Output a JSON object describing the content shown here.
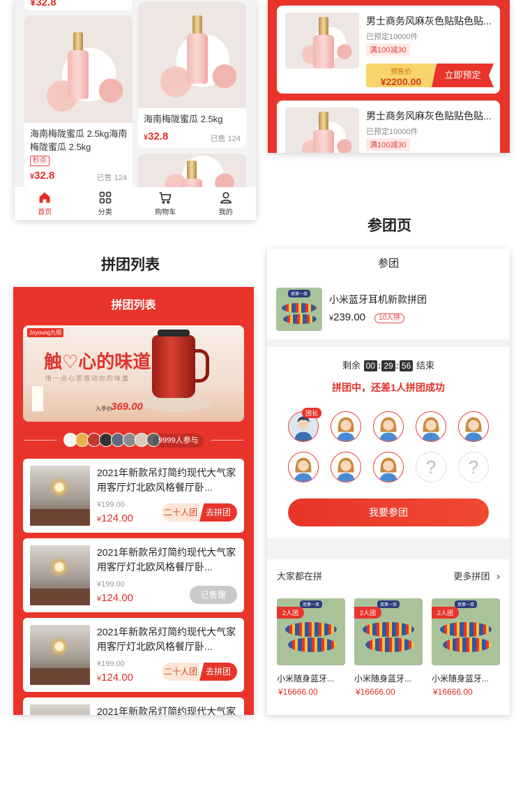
{
  "home": {
    "top_price_cut": "¥32.8",
    "cards": [
      {
        "title": "海南梅陇蜜瓜 2.5kg海南梅陇蜜瓜 2.5kg",
        "tag": "秒杀",
        "price_symbol": "¥",
        "price": "32.8",
        "sold": "已售 124"
      },
      {
        "title": "海南梅陇蜜瓜 2.5kg",
        "price_symbol": "¥",
        "price": "32.8",
        "sold": "已售 124"
      }
    ],
    "tabs": [
      {
        "label": "首页",
        "icon": "home-icon"
      },
      {
        "label": "分类",
        "icon": "category-icon"
      },
      {
        "label": "购物车",
        "icon": "cart-icon"
      },
      {
        "label": "我的",
        "icon": "user-icon"
      }
    ]
  },
  "presale": {
    "items": [
      {
        "title": "男士商务风麻灰色贴贴色贴...",
        "booked": "已预定10000件",
        "discount": "满100减30",
        "price_label": "预售价",
        "price": "¥2200.00",
        "button": "立即预定"
      },
      {
        "title": "男士商务风麻灰色贴贴色贴...",
        "booked": "已预定10000件",
        "discount": "满100减30"
      }
    ]
  },
  "section_titles": {
    "join_page": "参团页",
    "group_list": "拼团列表"
  },
  "group_list": {
    "header": "拼团列表",
    "banner": {
      "brand": "Joyoung九阳",
      "slogan": "触♡心的味道",
      "slogan_sub": "用一点心思感动你的味蕾",
      "price_label": "入手价",
      "price": "369.00"
    },
    "participants": "9999人参与",
    "items": [
      {
        "title": "2021年新款吊灯简约现代大气家用客厅灯北欧风格餐厅卧...",
        "old_price": "¥199.00",
        "price_symbol": "¥",
        "price": "124.00",
        "size_label": "二十人团",
        "action": "去拼团"
      },
      {
        "title": "2021年新款吊灯简约现代大气家用客厅灯北欧风格餐厅卧...",
        "old_price": "¥199.00",
        "price_symbol": "¥",
        "price": "124.00",
        "action": "已售罄"
      },
      {
        "title": "2021年新款吊灯简约现代大气家用客厅灯北欧风格餐厅卧...",
        "old_price": "¥199.00",
        "price_symbol": "¥",
        "price": "124.00",
        "size_label": "二十人团",
        "action": "去拼团"
      },
      {
        "title": "2021年新款吊灯简约现代大气家"
      }
    ]
  },
  "join_group": {
    "header": "参团",
    "product": {
      "pillow_label": "双第一双",
      "name": "小米蓝牙耳机新款拼团",
      "price_symbol": "¥",
      "price": "239.00",
      "group_size": "10人拼"
    },
    "countdown": {
      "prefix": "剩余",
      "hours": "00",
      "minutes": "29",
      "seconds": "56",
      "suffix": "结束",
      "sep": ":"
    },
    "status": "拼团中，还差1人拼团成功",
    "leader_tag": "团长",
    "empty_slot": "?",
    "join_button": "我要参团",
    "others_title": "大家都在拼",
    "more_label": "更多拼团",
    "others": [
      {
        "tag": "2人团",
        "label": "双第一双",
        "name": "小米随身蓝牙...",
        "price": "¥16666.00"
      },
      {
        "tag": "2人团",
        "label": "双第一双",
        "name": "小米随身蓝牙...",
        "price": "¥16666.00"
      },
      {
        "tag": "2人团",
        "label": "双第一双",
        "name": "小米随身蓝牙...",
        "price": "¥16666.00"
      }
    ]
  },
  "colors": {
    "accent": "#e8342a",
    "price": "#e02e24"
  }
}
